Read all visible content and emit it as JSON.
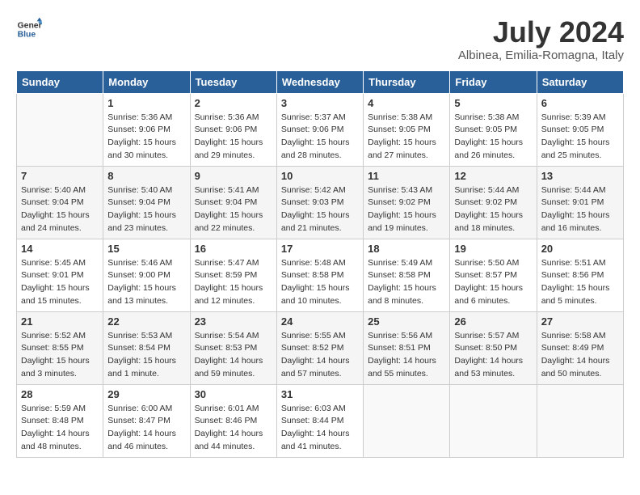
{
  "header": {
    "logo_line1": "General",
    "logo_line2": "Blue",
    "title": "July 2024",
    "subtitle": "Albinea, Emilia-Romagna, Italy"
  },
  "weekdays": [
    "Sunday",
    "Monday",
    "Tuesday",
    "Wednesday",
    "Thursday",
    "Friday",
    "Saturday"
  ],
  "weeks": [
    [
      {
        "day": "",
        "info": ""
      },
      {
        "day": "1",
        "info": "Sunrise: 5:36 AM\nSunset: 9:06 PM\nDaylight: 15 hours\nand 30 minutes."
      },
      {
        "day": "2",
        "info": "Sunrise: 5:36 AM\nSunset: 9:06 PM\nDaylight: 15 hours\nand 29 minutes."
      },
      {
        "day": "3",
        "info": "Sunrise: 5:37 AM\nSunset: 9:06 PM\nDaylight: 15 hours\nand 28 minutes."
      },
      {
        "day": "4",
        "info": "Sunrise: 5:38 AM\nSunset: 9:05 PM\nDaylight: 15 hours\nand 27 minutes."
      },
      {
        "day": "5",
        "info": "Sunrise: 5:38 AM\nSunset: 9:05 PM\nDaylight: 15 hours\nand 26 minutes."
      },
      {
        "day": "6",
        "info": "Sunrise: 5:39 AM\nSunset: 9:05 PM\nDaylight: 15 hours\nand 25 minutes."
      }
    ],
    [
      {
        "day": "7",
        "info": "Sunrise: 5:40 AM\nSunset: 9:04 PM\nDaylight: 15 hours\nand 24 minutes."
      },
      {
        "day": "8",
        "info": "Sunrise: 5:40 AM\nSunset: 9:04 PM\nDaylight: 15 hours\nand 23 minutes."
      },
      {
        "day": "9",
        "info": "Sunrise: 5:41 AM\nSunset: 9:04 PM\nDaylight: 15 hours\nand 22 minutes."
      },
      {
        "day": "10",
        "info": "Sunrise: 5:42 AM\nSunset: 9:03 PM\nDaylight: 15 hours\nand 21 minutes."
      },
      {
        "day": "11",
        "info": "Sunrise: 5:43 AM\nSunset: 9:02 PM\nDaylight: 15 hours\nand 19 minutes."
      },
      {
        "day": "12",
        "info": "Sunrise: 5:44 AM\nSunset: 9:02 PM\nDaylight: 15 hours\nand 18 minutes."
      },
      {
        "day": "13",
        "info": "Sunrise: 5:44 AM\nSunset: 9:01 PM\nDaylight: 15 hours\nand 16 minutes."
      }
    ],
    [
      {
        "day": "14",
        "info": "Sunrise: 5:45 AM\nSunset: 9:01 PM\nDaylight: 15 hours\nand 15 minutes."
      },
      {
        "day": "15",
        "info": "Sunrise: 5:46 AM\nSunset: 9:00 PM\nDaylight: 15 hours\nand 13 minutes."
      },
      {
        "day": "16",
        "info": "Sunrise: 5:47 AM\nSunset: 8:59 PM\nDaylight: 15 hours\nand 12 minutes."
      },
      {
        "day": "17",
        "info": "Sunrise: 5:48 AM\nSunset: 8:58 PM\nDaylight: 15 hours\nand 10 minutes."
      },
      {
        "day": "18",
        "info": "Sunrise: 5:49 AM\nSunset: 8:58 PM\nDaylight: 15 hours\nand 8 minutes."
      },
      {
        "day": "19",
        "info": "Sunrise: 5:50 AM\nSunset: 8:57 PM\nDaylight: 15 hours\nand 6 minutes."
      },
      {
        "day": "20",
        "info": "Sunrise: 5:51 AM\nSunset: 8:56 PM\nDaylight: 15 hours\nand 5 minutes."
      }
    ],
    [
      {
        "day": "21",
        "info": "Sunrise: 5:52 AM\nSunset: 8:55 PM\nDaylight: 15 hours\nand 3 minutes."
      },
      {
        "day": "22",
        "info": "Sunrise: 5:53 AM\nSunset: 8:54 PM\nDaylight: 15 hours\nand 1 minute."
      },
      {
        "day": "23",
        "info": "Sunrise: 5:54 AM\nSunset: 8:53 PM\nDaylight: 14 hours\nand 59 minutes."
      },
      {
        "day": "24",
        "info": "Sunrise: 5:55 AM\nSunset: 8:52 PM\nDaylight: 14 hours\nand 57 minutes."
      },
      {
        "day": "25",
        "info": "Sunrise: 5:56 AM\nSunset: 8:51 PM\nDaylight: 14 hours\nand 55 minutes."
      },
      {
        "day": "26",
        "info": "Sunrise: 5:57 AM\nSunset: 8:50 PM\nDaylight: 14 hours\nand 53 minutes."
      },
      {
        "day": "27",
        "info": "Sunrise: 5:58 AM\nSunset: 8:49 PM\nDaylight: 14 hours\nand 50 minutes."
      }
    ],
    [
      {
        "day": "28",
        "info": "Sunrise: 5:59 AM\nSunset: 8:48 PM\nDaylight: 14 hours\nand 48 minutes."
      },
      {
        "day": "29",
        "info": "Sunrise: 6:00 AM\nSunset: 8:47 PM\nDaylight: 14 hours\nand 46 minutes."
      },
      {
        "day": "30",
        "info": "Sunrise: 6:01 AM\nSunset: 8:46 PM\nDaylight: 14 hours\nand 44 minutes."
      },
      {
        "day": "31",
        "info": "Sunrise: 6:03 AM\nSunset: 8:44 PM\nDaylight: 14 hours\nand 41 minutes."
      },
      {
        "day": "",
        "info": ""
      },
      {
        "day": "",
        "info": ""
      },
      {
        "day": "",
        "info": ""
      }
    ]
  ]
}
